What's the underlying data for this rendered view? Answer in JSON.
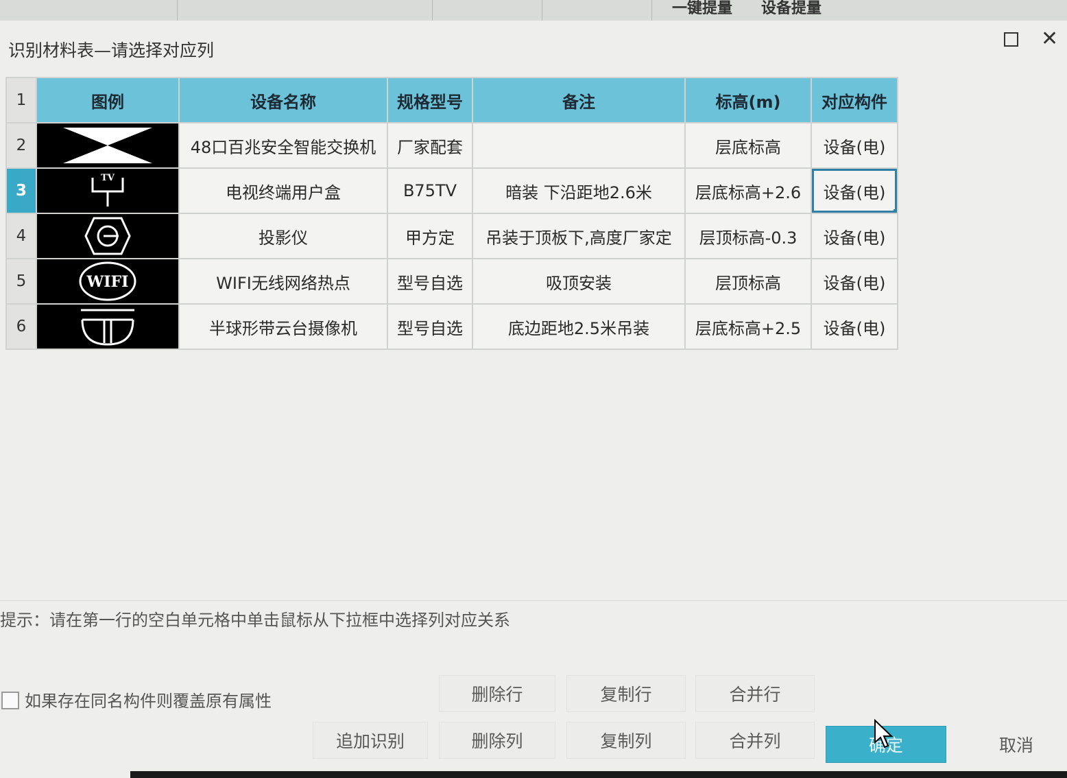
{
  "app": {
    "toolbar_items": [
      "一键提量",
      "设备提量"
    ]
  },
  "dialog": {
    "title": "识别材料表—请选择对应列",
    "maximize_icon": "maximize-icon",
    "close_icon": "close-icon"
  },
  "table": {
    "header_row_number": "1",
    "columns": [
      "图例",
      "设备名称",
      "规格型号",
      "备注",
      "标高(m)",
      "对应构件"
    ],
    "rows": [
      {
        "num": "2",
        "icon": "network-switch-symbol",
        "name": "48口百兆安全智能交换机",
        "spec": "厂家配套",
        "note": "",
        "elev": "层底标高",
        "comp": "设备(电)"
      },
      {
        "num": "3",
        "icon": "tv-outlet-symbol",
        "tv_label": "TV",
        "name": "电视终端用户盒",
        "spec": "B75TV",
        "note": "暗装 下沿距地2.6米",
        "elev": "层底标高+2.6",
        "comp": "设备(电)"
      },
      {
        "num": "4",
        "icon": "projector-symbol",
        "name": "投影仪",
        "spec": "甲方定",
        "note": "吊装于顶板下,高度厂家定",
        "elev": "层顶标高-0.3",
        "comp": "设备(电)"
      },
      {
        "num": "5",
        "icon": "wifi-hotspot-symbol",
        "wifi_label": "WIFI",
        "name": "WIFI无线网络热点",
        "spec": "型号自选",
        "note": "吸顶安装",
        "elev": "层顶标高",
        "comp": "设备(电)"
      },
      {
        "num": "6",
        "icon": "dome-camera-symbol",
        "name": "半球形带云台摄像机",
        "spec": "型号自选",
        "note": "底边距地2.5米吊装",
        "elev": "层底标高+2.5",
        "comp": "设备(电)"
      }
    ],
    "active_row": "3"
  },
  "hint": "提示：请在第一行的空白单元格中单击鼠标从下拉框中选择列对应关系",
  "options": {
    "overwrite_label": "如果存在同名构件则覆盖原有属性",
    "overwrite_checked": false
  },
  "buttons": {
    "append_recognize": "追加识别",
    "delete_row": "删除行",
    "copy_row": "复制行",
    "merge_row": "合并行",
    "delete_col": "删除列",
    "copy_col": "复制列",
    "merge_col": "合并列",
    "ok": "确定",
    "cancel": "取消"
  },
  "colors": {
    "header_accent": "#6cc3d9",
    "active_row": "#3aa9c8",
    "primary_button": "#3bb0cb"
  }
}
